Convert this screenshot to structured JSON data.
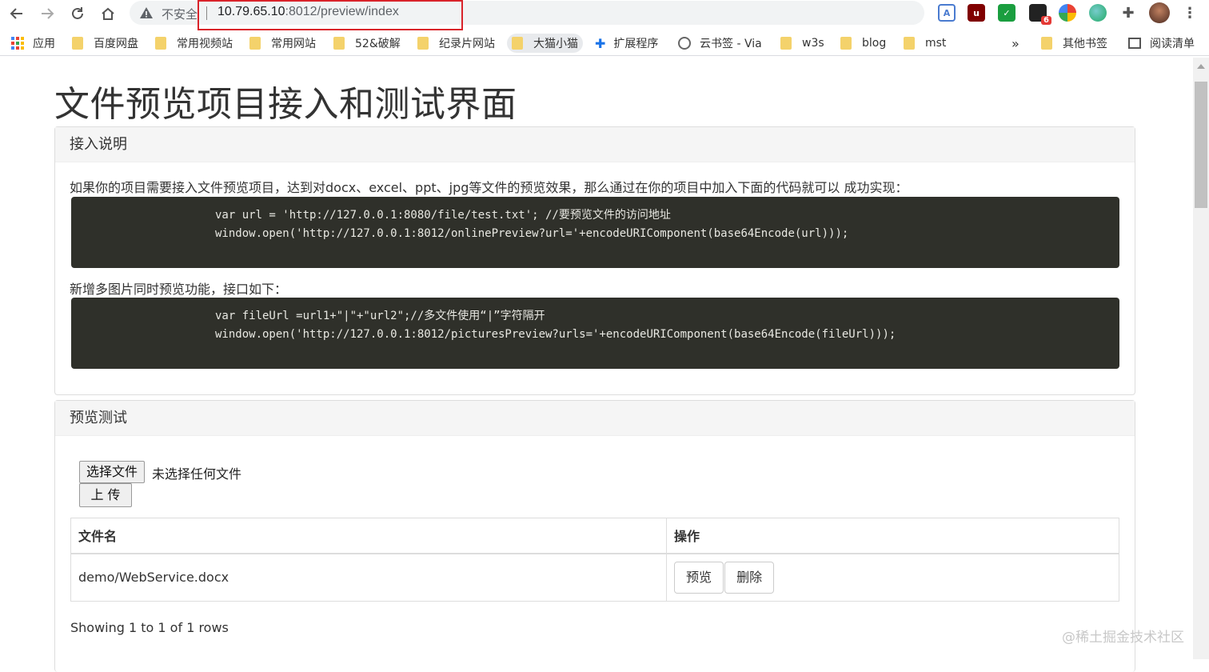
{
  "browser": {
    "insecure_label": "不安全",
    "url_host": "10.79.65.10",
    "url_path": ":8012/preview/index",
    "accent": "#d9232a",
    "extension_badge": "6",
    "bookmarks": {
      "apps": "应用",
      "items": [
        "百度网盘",
        "常用视频站",
        "常用网站",
        "52&破解",
        "纪录片网站",
        "大猫小猫",
        "扩展程序",
        "云书签 - Via",
        "w3s",
        "blog",
        "mst"
      ],
      "overflow": "»",
      "other": "其他书签",
      "reading_list": "阅读清单"
    }
  },
  "page": {
    "title": "文件预览项目接入和测试界面",
    "access": {
      "heading": "接入说明",
      "intro": "如果你的项目需要接入文件预览项目，达到对docx、excel、ppt、jpg等文件的预览效果，那么通过在你的项目中加入下面的代码就可以 成功实现：",
      "code1_line1": "var url = 'http://127.0.0.1:8080/file/test.txt'; //要预览文件的访问地址",
      "code1_line2": "window.open('http://127.0.0.1:8012/onlinePreview?url='+encodeURIComponent(base64Encode(url)));",
      "multi_intro": "新增多图片同时预览功能，接口如下：",
      "code2_line1": "var fileUrl =url1+\"|\"+\"url2\";//多文件使用“|”字符隔开",
      "code2_line2": "window.open('http://127.0.0.1:8012/picturesPreview?urls='+encodeURIComponent(base64Encode(fileUrl)));"
    },
    "test": {
      "heading": "预览测试",
      "choose_file": "选择文件",
      "no_file": "未选择任何文件",
      "upload": "上 传",
      "table": {
        "col_name": "文件名",
        "col_action": "操作",
        "rows": [
          {
            "name": "demo/WebService.docx",
            "preview": "预览",
            "delete": "删除"
          }
        ]
      },
      "showing": "Showing 1 to 1 of 1 rows"
    },
    "watermark": "@稀土掘金技术社区"
  }
}
